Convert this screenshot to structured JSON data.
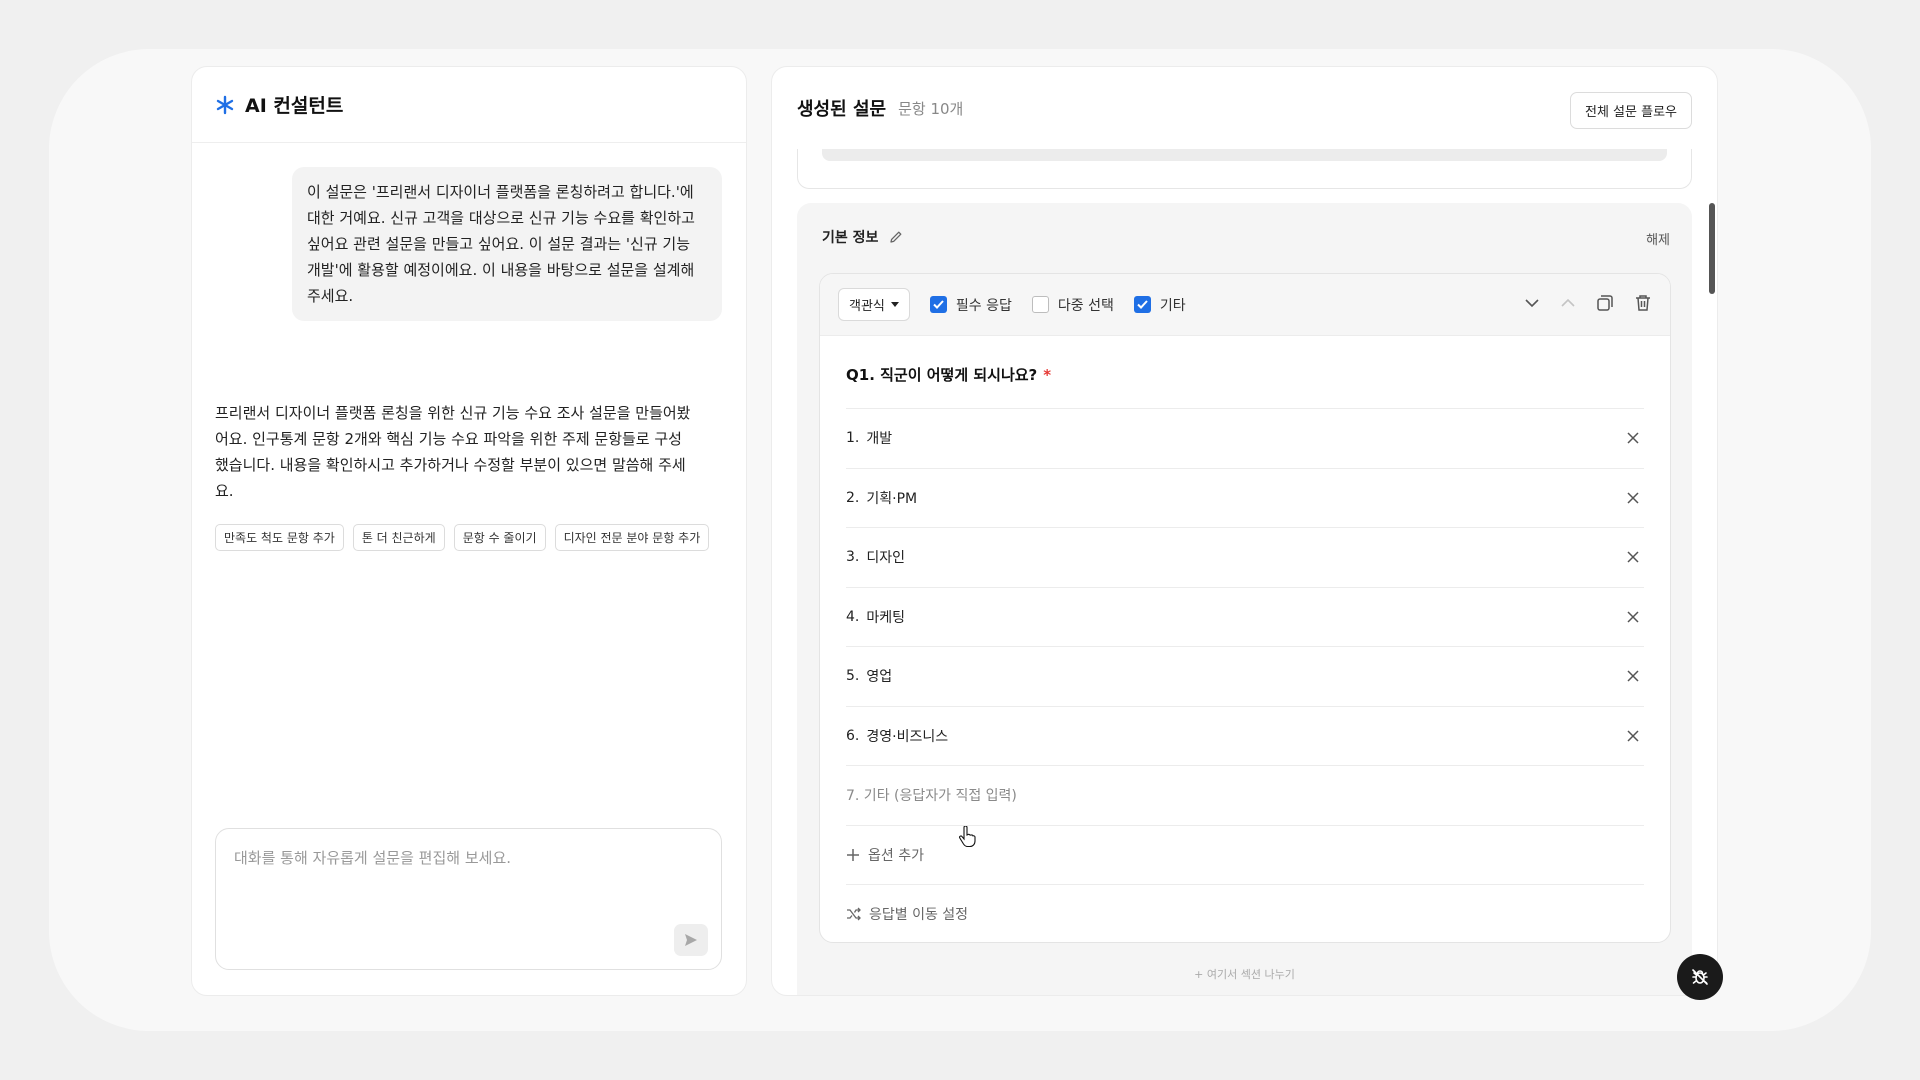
{
  "left_panel": {
    "title": "AI 컨설턴트",
    "user_message": "이 설문은 '프리랜서 디자이너 플랫폼을 론칭하려고 합니다.'에 대한 거예요. 신규 고객을 대상으로 신규 기능 수요를 확인하고 싶어요 관련 설문을 만들고 싶어요. 이 설문 결과는 '신규 기능 개발'에 활용할 예정이에요. 이 내용을 바탕으로 설문을 설계해 주세요.",
    "ai_message": "프리랜서 디자이너 플랫폼 론칭을 위한 신규 기능 수요 조사 설문을 만들어봤어요. 인구통계 문항 2개와 핵심 기능 수요 파악을 위한 주제 문항들로 구성했습니다. 내용을 확인하시고 추가하거나 수정할 부분이 있으면 말씀해 주세요.",
    "chips": [
      "만족도 척도 문항 추가",
      "톤 더 친근하게",
      "문항 수 줄이기",
      "디자인 전문 분야 문항 추가"
    ],
    "input_placeholder": "대화를 통해 자유롭게 설문을 편집해 보세요."
  },
  "right_panel": {
    "title": "생성된 설문",
    "count": "문항 10개",
    "flow_button": "전체 설문 플로우",
    "section": {
      "title": "기본 정보",
      "release": "해제",
      "question": {
        "type": "객관식",
        "required_label": "필수 응답",
        "required": true,
        "multi_label": "다중 선택",
        "multi": false,
        "other_label": "기타",
        "other": true,
        "title": "Q1.  직군이 어떻게 되시나요?",
        "required_mark": "*",
        "options": [
          {
            "num": "1.",
            "label": "개발"
          },
          {
            "num": "2.",
            "label": "기획·PM"
          },
          {
            "num": "3.",
            "label": "디자인"
          },
          {
            "num": "4.",
            "label": "마케팅"
          },
          {
            "num": "5.",
            "label": "영업"
          },
          {
            "num": "6.",
            "label": "경영·비즈니스"
          }
        ],
        "other_option": "7. 기타 (응답자가 직접 입력)",
        "add_option": "옵션 추가",
        "jump_setting": "응답별 이동 설정"
      },
      "split_here": "+ 여기서 섹션 나누기"
    }
  },
  "colors": {
    "accent": "#1f6fe5",
    "required": "#e53935",
    "fab": "#1a1a1a"
  }
}
